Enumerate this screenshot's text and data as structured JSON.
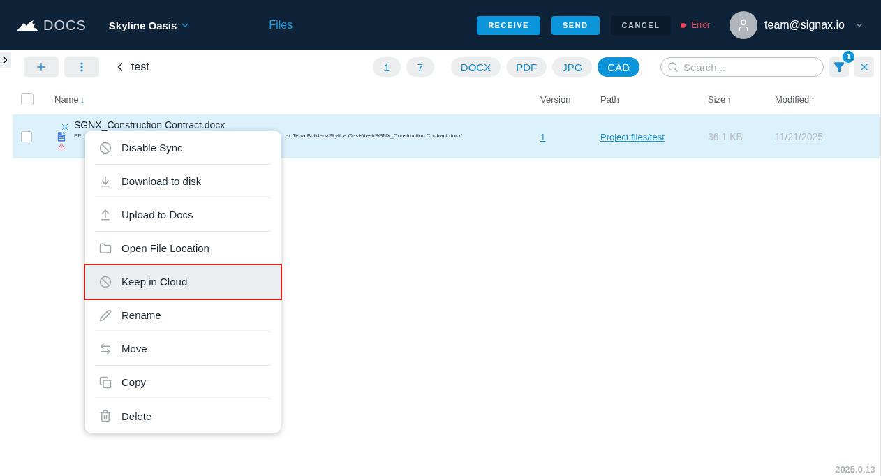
{
  "header": {
    "logo": "DOCS",
    "project": "Skyline Oasis",
    "nav": "Files",
    "buttons": [
      {
        "label": "RECEIVE",
        "kind": "primary"
      },
      {
        "label": "SEND",
        "kind": "primary"
      },
      {
        "label": "CANCEL",
        "kind": "dark"
      }
    ],
    "status": "Error",
    "user": "team@signax.io"
  },
  "toolbar": {
    "folder": "test",
    "counts": [
      "1",
      "7"
    ],
    "filters": [
      {
        "label": "DOCX",
        "selected": false
      },
      {
        "label": "PDF",
        "selected": false
      },
      {
        "label": "JPG",
        "selected": false
      },
      {
        "label": "CAD",
        "selected": true
      }
    ],
    "search": {
      "placeholder": "Search..."
    },
    "filter_badge": "1"
  },
  "table": {
    "select_all": {
      "checked": false
    },
    "columns": [
      {
        "label": "Name",
        "sort_arrow": "↓"
      },
      {
        "label": "Version"
      },
      {
        "label": "Path"
      },
      {
        "label": "Size",
        "sort_arrow": "↑"
      },
      {
        "label": "Modified",
        "sort_arrow": "↑"
      }
    ],
    "rows": [
      {
        "name": "SGNX_Construction Contract.docx",
        "error_start": "EE",
        "error_end": "ex Terra Builders\\Skyline Oasis\\test\\SGNX_Construction Contract.docx'",
        "version": "1",
        "path": "Project files/test",
        "size": "36.1 KB",
        "modified": "11/21/2025",
        "selected": true,
        "checked": false
      }
    ]
  },
  "context_menu": [
    {
      "label": "Disable Sync",
      "selected": false
    },
    {
      "label": "Download to disk",
      "selected": false
    },
    {
      "label": "Upload to Docs",
      "selected": false
    },
    {
      "label": "Open File Location",
      "selected": false
    },
    {
      "label": "Keep in Cloud",
      "selected": true
    },
    {
      "label": "Rename",
      "selected": false
    },
    {
      "label": "Move",
      "selected": false
    },
    {
      "label": "Copy",
      "selected": false
    },
    {
      "label": "Delete",
      "selected": false
    }
  ],
  "version": "2025.0.13"
}
